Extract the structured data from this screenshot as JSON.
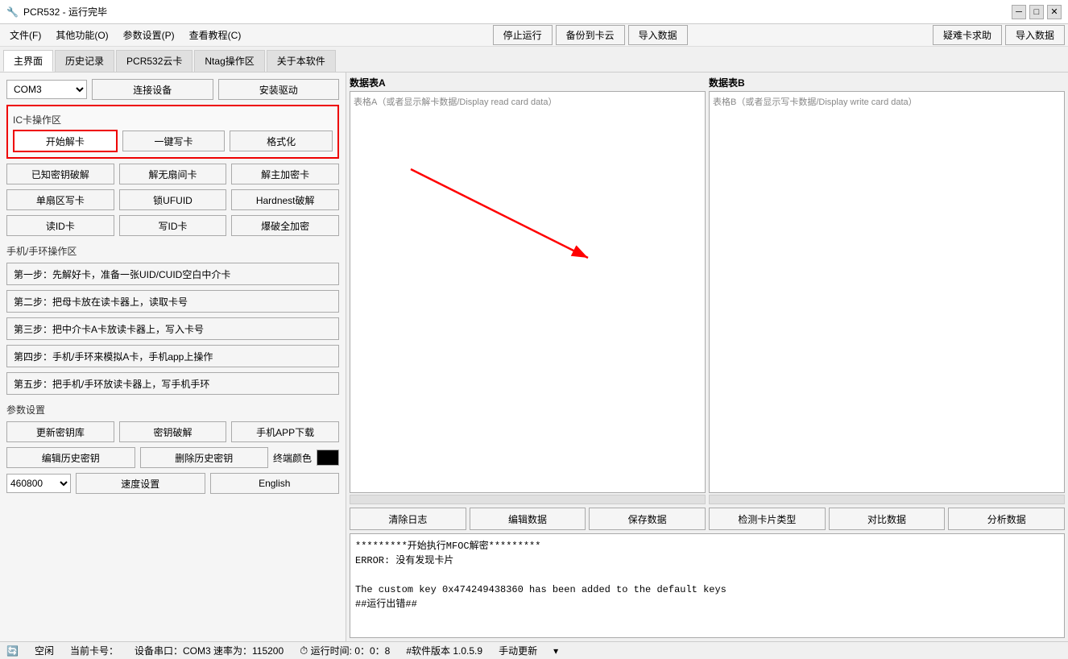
{
  "titlebar": {
    "title": "PCR532 - 运行完毕",
    "icon": "🔧",
    "minimize": "─",
    "restore": "□",
    "close": "✕"
  },
  "menubar": {
    "items": [
      {
        "label": "文件(F)"
      },
      {
        "label": "其他功能(O)"
      },
      {
        "label": "参数设置(P)"
      },
      {
        "label": "查看教程(C)"
      }
    ],
    "center_buttons": [
      {
        "label": "停止运行"
      },
      {
        "label": "备份到卡云"
      },
      {
        "label": "导入数据"
      }
    ],
    "right_buttons": [
      {
        "label": "疑难卡求助"
      },
      {
        "label": "导入数据"
      }
    ]
  },
  "tabs": [
    {
      "label": "主界面",
      "active": true
    },
    {
      "label": "历史记录"
    },
    {
      "label": "PCR532云卡"
    },
    {
      "label": "Ntag操作区"
    },
    {
      "label": "关于本软件"
    }
  ],
  "left_panel": {
    "com_select": "COM3",
    "connect_btn": "连接设备",
    "install_btn": "安装驱动",
    "ic_group_label": "IC卡操作区",
    "start_decode_btn": "开始解卡",
    "one_click_write_btn": "一键写卡",
    "format_btn": "格式化",
    "known_key_btn": "已知密钥破解",
    "unlock_door_btn": "解无扇间卡",
    "unlock_enc_btn": "解主加密卡",
    "single_write_btn": "单扇区写卡",
    "lock_uid_btn": "锁UFUID",
    "hardnest_btn": "Hardnest破解",
    "read_id_btn": "读ID卡",
    "write_id_btn": "写ID卡",
    "brute_enc_btn": "爆破全加密",
    "phone_group_label": "手机/手环操作区",
    "step1": "第一步：先解好卡，准备一张UID/CUID空白中介卡",
    "step2": "第二步：把母卡放在读卡器上，读取卡号",
    "step3": "第三步：把中介卡A卡放读卡器上，写入卡号",
    "step4": "第四步：手机/手环来模拟A卡，手机app上操作",
    "step5": "第五步：把手机/手环放读卡器上，写手机手环",
    "param_label": "参数设置",
    "update_keys_btn": "更新密钥库",
    "crack_key_btn": "密钥破解",
    "download_app_btn": "手机APP下载",
    "edit_history_btn": "编辑历史密钥",
    "delete_history_btn": "删除历史密钥",
    "terminal_color_label": "终端颜色",
    "baud_select": "460800",
    "speed_btn": "速度设置",
    "lang_btn": "English"
  },
  "right_panel": {
    "table_a_label": "数据表A",
    "table_a_hint": "表格A（或者显示解卡数据/Display read card data）",
    "table_b_label": "数据表B",
    "table_b_hint": "表格B（或者显示写卡数据/Display write card data）",
    "action_buttons": [
      {
        "label": "清除日志"
      },
      {
        "label": "编辑数据"
      },
      {
        "label": "保存数据"
      },
      {
        "label": "检测卡片类型"
      },
      {
        "label": "对比数据"
      },
      {
        "label": "分析数据"
      }
    ],
    "terminal_lines": [
      "*********开始执行MFOC解密*********",
      "ERROR: 没有发现卡片",
      "",
      "The custom key 0x474249438360 has been added to the default keys",
      "##运行出错##"
    ]
  },
  "statusbar": {
    "idle": "空闲",
    "card_label": "当前卡号：",
    "device_info": "设备串口：COM3 速率为：115200",
    "run_time_label": "运行时间:",
    "run_time": "0：0：8",
    "version": "#软件版本 1.0.5.9",
    "update": "手动更新"
  }
}
